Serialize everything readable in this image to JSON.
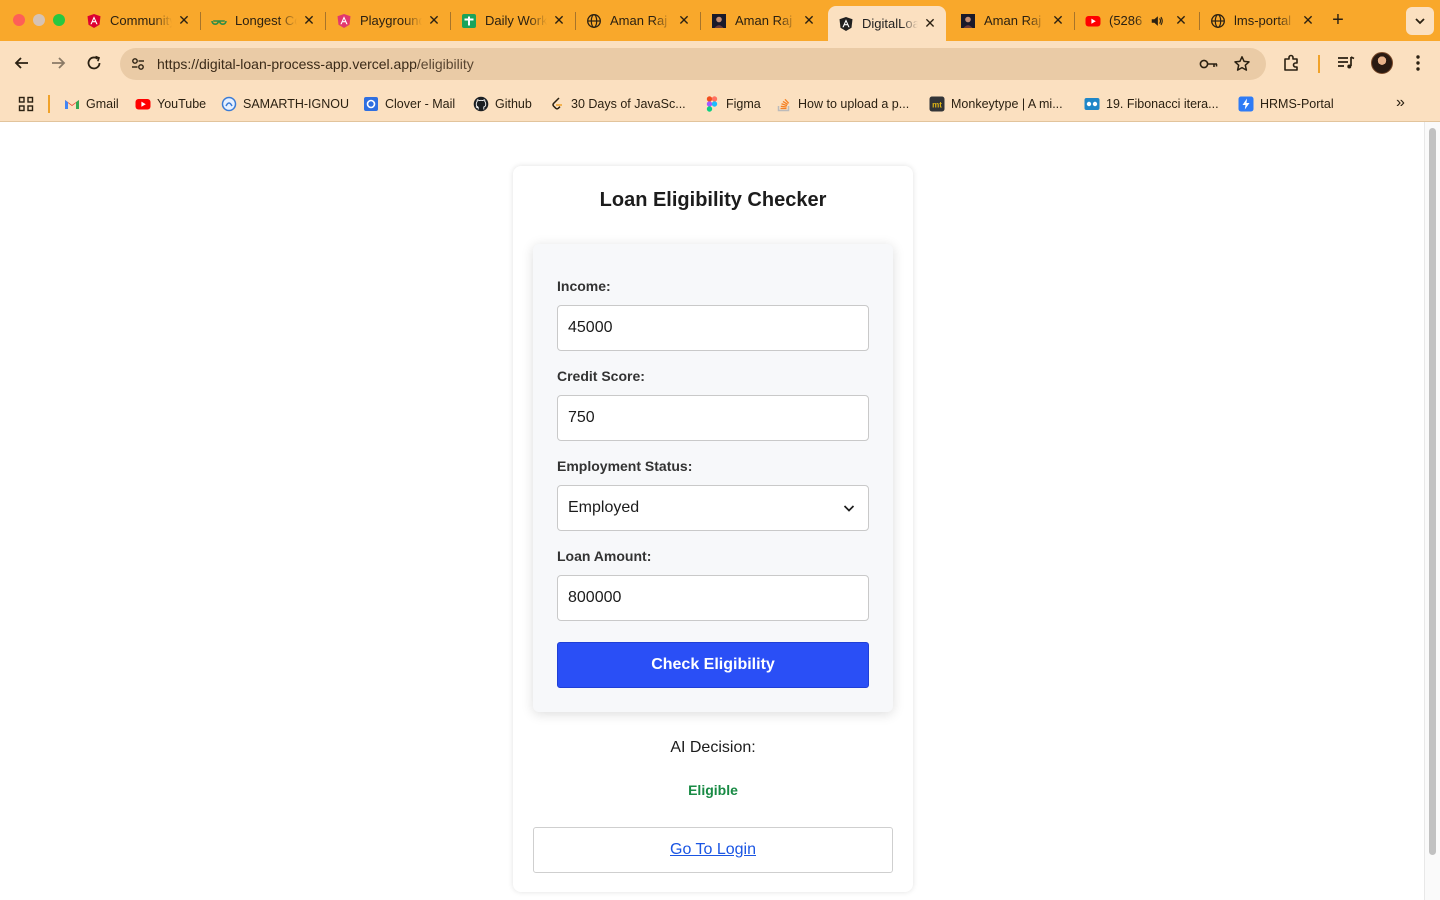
{
  "browser": {
    "tabs": [
      {
        "title": "Community",
        "icon": "angular-icon",
        "active": false
      },
      {
        "title": "Longest Common",
        "icon": "geeksforgeeks-icon",
        "active": false
      },
      {
        "title": "Playground",
        "icon": "angular-icon",
        "active": false
      },
      {
        "title": "Daily Work",
        "icon": "sheets-plus-icon",
        "active": false
      },
      {
        "title": "Aman Raj",
        "icon": "globe-icon",
        "active": false
      },
      {
        "title": "Aman Raj",
        "icon": "profile-photo-icon",
        "active": false
      },
      {
        "title": "DigitalLoan",
        "icon": "angular-dark-icon",
        "active": true
      },
      {
        "title": "Aman Raj",
        "icon": "profile-photo-icon",
        "active": false
      },
      {
        "title": "(5286",
        "icon": "youtube-icon",
        "active": false
      },
      {
        "title": "lms-portal",
        "icon": "globe-icon",
        "active": false
      }
    ],
    "url_scheme_host": "https://digital-loan-process-app.vercel.app",
    "url_path": "/eligibility",
    "bookmarks": [
      {
        "label": "Gmail",
        "icon": "gmail-icon"
      },
      {
        "label": "YouTube",
        "icon": "youtube-icon"
      },
      {
        "label": "SAMARTH-IGNOU",
        "icon": "samarth-icon"
      },
      {
        "label": "Clover - Mail",
        "icon": "clover-mail-icon"
      },
      {
        "label": "Github",
        "icon": "github-icon"
      },
      {
        "label": "30 Days of JavaSc...",
        "icon": "leetcode-icon"
      },
      {
        "label": "Figma",
        "icon": "figma-icon"
      },
      {
        "label": "How to upload a p...",
        "icon": "stackoverflow-icon"
      },
      {
        "label": "Monkeytype | A mi...",
        "icon": "monkeytype-icon"
      },
      {
        "label": "19. Fibonacci itera...",
        "icon": "video-icon"
      },
      {
        "label": "HRMS-Portal",
        "icon": "lightning-icon"
      }
    ],
    "colors": {
      "tabstrip": "#f9a82b",
      "toolbar": "#fbe0c0"
    }
  },
  "page": {
    "title": "Loan Eligibility Checker",
    "form": {
      "income_label": "Income:",
      "income_value": "45000",
      "credit_label": "Credit Score:",
      "credit_value": "750",
      "employment_label": "Employment Status:",
      "employment_value": "Employed",
      "loan_label": "Loan Amount:",
      "loan_value": "800000",
      "submit_label": "Check Eligibility"
    },
    "ai_label": "AI Decision:",
    "ai_result": "Eligible",
    "login_link": "Go To Login",
    "colors": {
      "primary_button": "#2a4ff6",
      "eligible": "#188a44",
      "link": "#1a55e3"
    }
  }
}
